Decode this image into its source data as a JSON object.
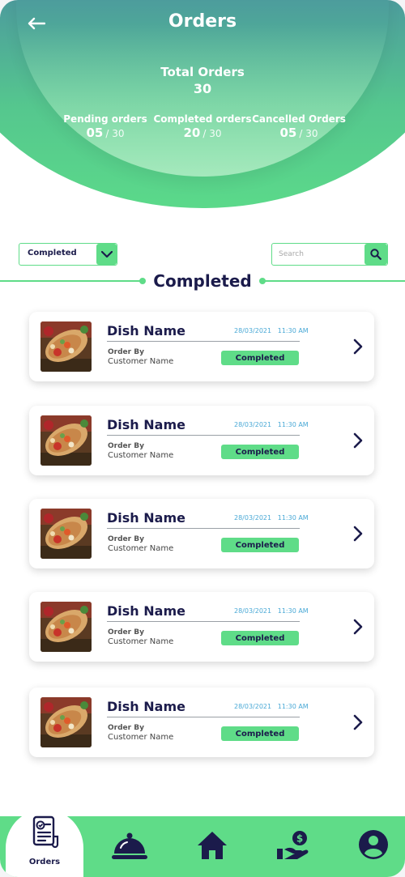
{
  "header": {
    "title": "Orders",
    "total_label": "Total Orders",
    "total_value": "30",
    "stats": [
      {
        "label": "Pending orders",
        "value": "05",
        "denominator": "/ 30"
      },
      {
        "label": "Completed orders",
        "value": "20",
        "denominator": "/ 30"
      },
      {
        "label": "Cancelled Orders",
        "value": "05",
        "denominator": "/ 30"
      }
    ]
  },
  "filters": {
    "status_selected": "Completed",
    "search_placeholder": "Search"
  },
  "section_title": "Completed",
  "orders": [
    {
      "dish": "Dish Name",
      "date": "28/03/2021   11:30 AM",
      "order_by_label": "Order By",
      "customer": "Customer Name",
      "status": "Completed"
    },
    {
      "dish": "Dish Name",
      "date": "28/03/2021   11:30 AM",
      "order_by_label": "Order By",
      "customer": "Customer Name",
      "status": "Completed"
    },
    {
      "dish": "Dish Name",
      "date": "28/03/2021   11:30 AM",
      "order_by_label": "Order By",
      "customer": "Customer Name",
      "status": "Completed"
    },
    {
      "dish": "Dish Name",
      "date": "28/03/2021   11:30 AM",
      "order_by_label": "Order By",
      "customer": "Customer Name",
      "status": "Completed"
    },
    {
      "dish": "Dish Name",
      "date": "28/03/2021   11:30 AM",
      "order_by_label": "Order By",
      "customer": "Customer Name",
      "status": "Completed"
    }
  ],
  "nav": {
    "active_label": "Orders",
    "items": [
      "orders-icon",
      "cloche-icon",
      "home-icon",
      "hand-money-icon",
      "profile-icon"
    ]
  },
  "colors": {
    "accent_green": "#5fdc88",
    "navy": "#1b1b4b",
    "header_top": "#4567a8",
    "date_blue": "#4aa9d6"
  }
}
